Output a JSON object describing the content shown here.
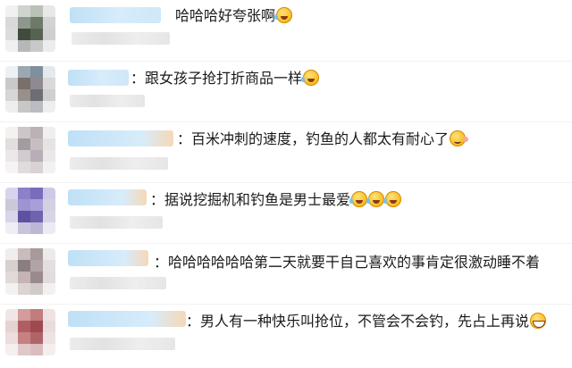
{
  "comments": [
    {
      "text": "哈哈哈好夸张啊",
      "emojis": [
        "cry-laugh-icon"
      ]
    },
    {
      "text": "：跟女孩子抢打折商品一样",
      "emojis": [
        "cry-laugh-icon"
      ]
    },
    {
      "text": "：百米冲刺的速度，钓鱼的人都太有耐心了",
      "emojis": [
        "smirk-icon"
      ]
    },
    {
      "text": "：据说挖掘机和钓鱼是男士最爱",
      "emojis": [
        "cry-laugh-icon",
        "cry-laugh-icon",
        "cry-laugh-icon"
      ]
    },
    {
      "text": "：哈哈哈哈哈哈第二天就要干自己喜欢的事肯定很激动睡不着",
      "emojis": []
    },
    {
      "text": "：男人有一种快乐叫抢位，不管会不会钓，先占上再说",
      "emojis": [
        "grin-icon"
      ]
    }
  ],
  "colors": {
    "name_blur": "#cfe7f8",
    "subtitle_blur": "#e6e6e6",
    "emoji": "#f5b91b"
  }
}
